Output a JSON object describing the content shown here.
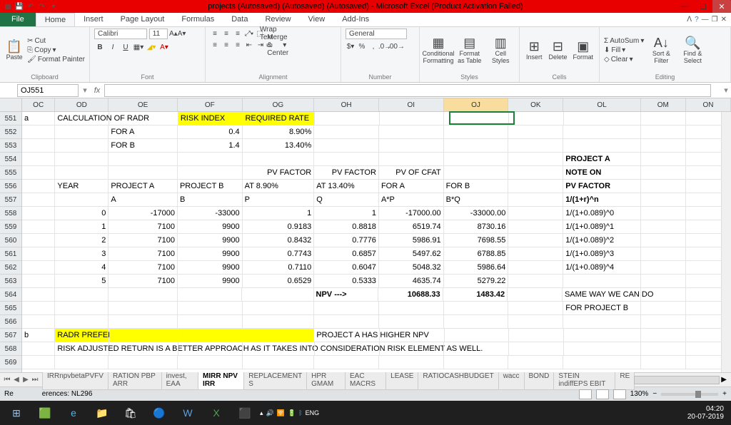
{
  "title": "projects (Autosaved) (Autosaved) (Autosaved) - Microsoft Excel (Product Activation Failed)",
  "tabs": {
    "file": "File",
    "home": "Home",
    "insert": "Insert",
    "pagelayout": "Page Layout",
    "formulas": "Formulas",
    "data": "Data",
    "review": "Review",
    "view": "View",
    "addins": "Add-Ins"
  },
  "ribbon": {
    "clipboard": {
      "label": "Clipboard",
      "paste": "Paste",
      "cut": "Cut",
      "copy": "Copy",
      "painter": "Format Painter"
    },
    "font": {
      "label": "Font",
      "name": "Calibri",
      "size": "11"
    },
    "alignment": {
      "label": "Alignment",
      "wrap": "Wrap Text",
      "merge": "Merge & Center"
    },
    "number": {
      "label": "Number",
      "format": "General"
    },
    "styles": {
      "label": "Styles",
      "cond": "Conditional Formatting",
      "table": "Format as Table",
      "cell": "Cell Styles"
    },
    "cells": {
      "label": "Cells",
      "insert": "Insert",
      "delete": "Delete",
      "format": "Format"
    },
    "editing": {
      "label": "Editing",
      "autosum": "AutoSum",
      "fill": "Fill",
      "clear": "Clear",
      "sort": "Sort & Filter",
      "find": "Find & Select"
    }
  },
  "namebox": "OJ551",
  "columns": [
    "OC",
    "OD",
    "OE",
    "OF",
    "OG",
    "OH",
    "OI",
    "OJ",
    "OK",
    "OL",
    "OM",
    "ON"
  ],
  "rows": [
    "551",
    "552",
    "553",
    "554",
    "555",
    "556",
    "557",
    "558",
    "559",
    "560",
    "561",
    "562",
    "563",
    "564",
    "565",
    "566",
    "567",
    "568",
    "569"
  ],
  "cells": {
    "551": {
      "OC": "a",
      "OD": "CALCULATION OF RADR",
      "OF": "RISK INDEX",
      "OG": "REQUIRED RATE"
    },
    "552": {
      "OE": "FOR A",
      "OF": "0.4",
      "OG": "8.90%"
    },
    "553": {
      "OE": "FOR B",
      "OF": "1.4",
      "OG": "13.40%"
    },
    "554": {
      "OL": "PROJECT A"
    },
    "555": {
      "OG": "PV FACTOR",
      "OH": "PV FACTOR",
      "OI": "PV OF CFAT",
      "OL": "NOTE ON"
    },
    "556": {
      "OD": "YEAR",
      "OE": "PROJECT A",
      "OF": "PROJECT B",
      "OG": "AT 8.90%",
      "OH": "AT 13.40%",
      "OI": "FOR A",
      "OJ": "FOR B",
      "OL": "PV FACTOR"
    },
    "557": {
      "OE": "A",
      "OF": "B",
      "OG": "P",
      "OH": "Q",
      "OI": "A*P",
      "OJ": "B*Q",
      "OL": "1/(1+r)^n"
    },
    "558": {
      "OD": "0",
      "OE": "-17000",
      "OF": "-33000",
      "OG": "1",
      "OH": "1",
      "OI": "-17000.00",
      "OJ": "-33000.00",
      "OL": "1/(1+0.089)^0"
    },
    "559": {
      "OD": "1",
      "OE": "7100",
      "OF": "9900",
      "OG": "0.9183",
      "OH": "0.8818",
      "OI": "6519.74",
      "OJ": "8730.16",
      "OL": "1/(1+0.089)^1"
    },
    "560": {
      "OD": "2",
      "OE": "7100",
      "OF": "9900",
      "OG": "0.8432",
      "OH": "0.7776",
      "OI": "5986.91",
      "OJ": "7698.55",
      "OL": "1/(1+0.089)^2"
    },
    "561": {
      "OD": "3",
      "OE": "7100",
      "OF": "9900",
      "OG": "0.7743",
      "OH": "0.6857",
      "OI": "5497.62",
      "OJ": "6788.85",
      "OL": "1/(1+0.089)^3"
    },
    "562": {
      "OD": "4",
      "OE": "7100",
      "OF": "9900",
      "OG": "0.7110",
      "OH": "0.6047",
      "OI": "5048.32",
      "OJ": "5986.64",
      "OL": "1/(1+0.089)^4"
    },
    "563": {
      "OD": "5",
      "OE": "7100",
      "OF": "9900",
      "OG": "0.6529",
      "OH": "0.5333",
      "OI": "4635.74",
      "OJ": "5279.22"
    },
    "564": {
      "OH": "NPV --->",
      "OI": "10688.33",
      "OJ": "1483.42",
      "OL": "SAME WAY WE CAN DO"
    },
    "565": {
      "OL": "FOR PROJECT B"
    },
    "567": {
      "OC": "b",
      "OD": "RADR PREFERS PROJECT A OVER PROJECT B",
      "OH": "PROJECT A HAS HIGHER NPV"
    },
    "568": {
      "OD": "RISK ADJUSTED RETURN IS A BETTER APPROACH AS IT TAKES INTO CONSIDERATION RISK ELEMENT AS WELL."
    }
  },
  "sheets": [
    "IRRnpvbetaPVFV",
    "RATION PBP ARR",
    "invest, EAA",
    "MIRR NPV IRR",
    "REPLACEMENT S",
    "HPR GMAM",
    "EAC MACRS",
    "LEASE",
    "RATIOCASHBUDGET",
    "wacc",
    "BOND",
    "STEIN indiffEPS EBIT",
    "RE"
  ],
  "activesheet": "MIRR NPV IRR",
  "status": {
    "left": "Re",
    "ref": "erences: NL296",
    "zoom": "130%"
  },
  "clock": {
    "time": "04:20",
    "date": "20-07-2019",
    "lang": "ENG"
  }
}
